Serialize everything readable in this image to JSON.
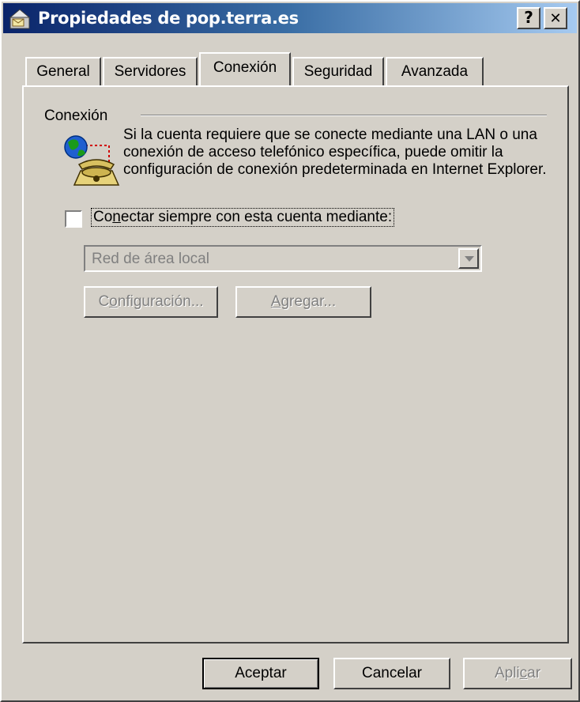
{
  "window": {
    "title": "Propiedades de pop.terra.es",
    "help_button": "?",
    "close_button": "✕"
  },
  "tabs": [
    {
      "label": "General"
    },
    {
      "label": "Servidores"
    },
    {
      "label": "Conexión"
    },
    {
      "label": "Seguridad"
    },
    {
      "label": "Avanzada"
    }
  ],
  "active_tab": "Conexión",
  "connection": {
    "group_label": "Conexión",
    "description": "Si la cuenta requiere que se conecte mediante una LAN o una conexión de acceso telefónico específica, puede omitir la configuración de conexión predeterminada en Internet Explorer.",
    "checkbox_label_pre": "Co",
    "checkbox_label_u": "n",
    "checkbox_label_post": "ectar siempre con esta cuenta mediante:",
    "checkbox_checked": false,
    "select_value": "Red de área local",
    "settings_button_pre": "C",
    "settings_button_u": "o",
    "settings_button_post": "nfiguración...",
    "add_button_pre": "",
    "add_button_u": "A",
    "add_button_post": "gregar..."
  },
  "footer": {
    "ok_label": "Aceptar",
    "cancel_label": "Cancelar",
    "apply_pre": "Apli",
    "apply_u": "c",
    "apply_post": "ar"
  },
  "icons": {
    "title_icon": "mail-account-icon",
    "connection_icon": "globe-phone-icon"
  }
}
